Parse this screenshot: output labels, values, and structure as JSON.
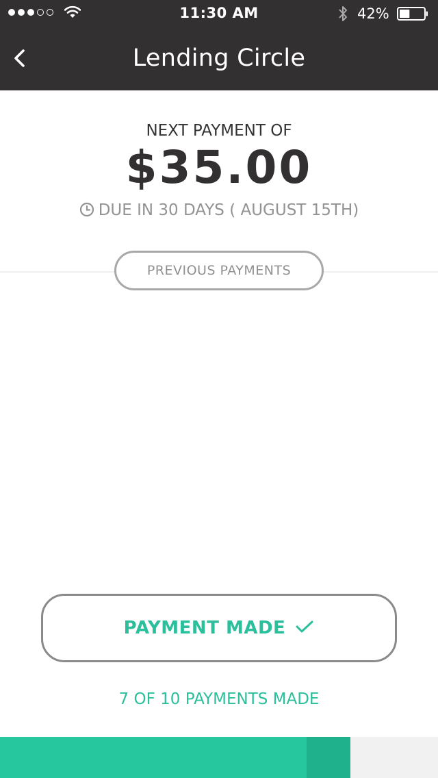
{
  "status_bar": {
    "signal_full": 3,
    "signal_total": 5,
    "time": "11:30 AM",
    "battery_percent_text": "42%",
    "battery_level": 0.42,
    "icons": [
      "signal-dots",
      "wifi-icon",
      "bluetooth-icon",
      "battery-icon"
    ]
  },
  "nav": {
    "title": "Lending Circle",
    "back_icon": "chevron-left-icon"
  },
  "payment": {
    "next_label": "NEXT PAYMENT OF",
    "amount": "$35.00",
    "due_text": "DUE IN 30 DAYS ( AUGUST 15TH)",
    "due_icon": "clock-icon"
  },
  "previous_payments_label": "PREVIOUS PAYMENTS",
  "payment_made": {
    "label": "PAYMENT MADE",
    "icon": "check-icon"
  },
  "progress": {
    "text": "7 OF 10 PAYMENTS MADE",
    "made": 7,
    "current": 1,
    "total": 10
  },
  "colors": {
    "header_bg": "#323031",
    "accent": "#26c79f",
    "accent_dark": "#1fb18b",
    "text_accent": "#2bbf9b",
    "track": "#f1f1f1"
  }
}
